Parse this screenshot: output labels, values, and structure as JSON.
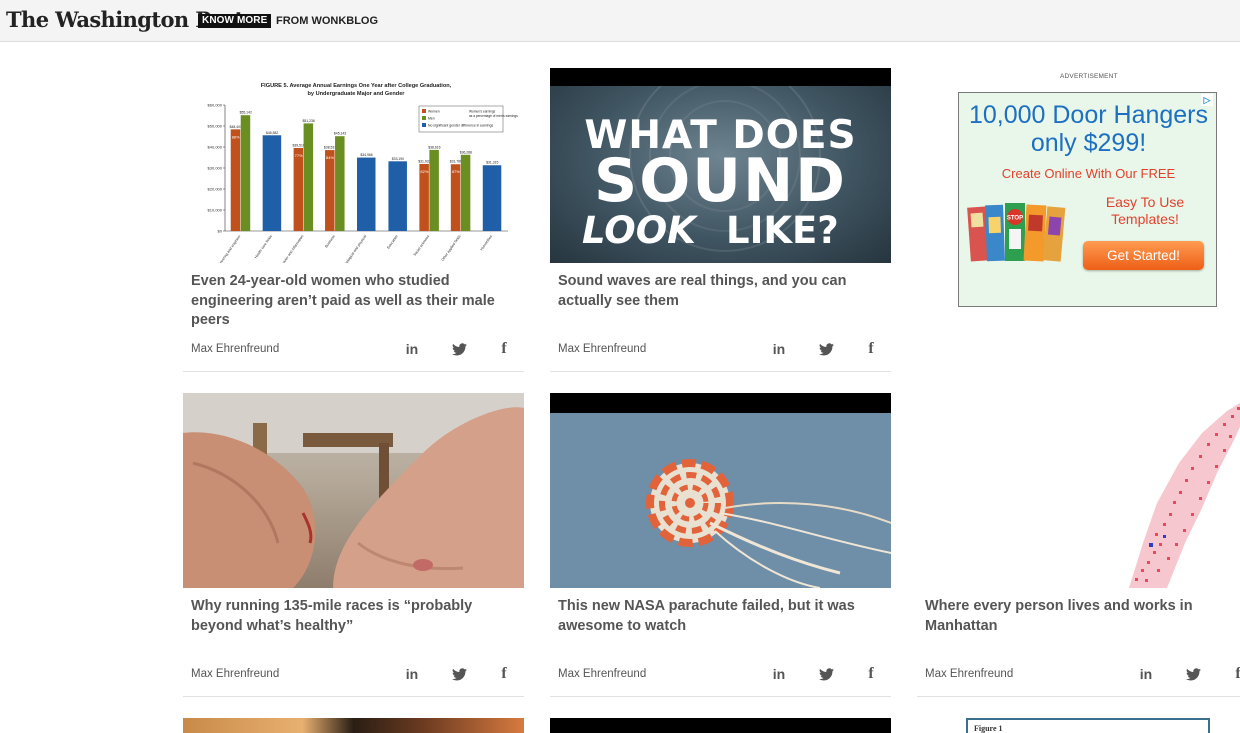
{
  "header": {
    "logo": "The Washington Post",
    "badge": "KNOW MORE",
    "section": "FROM WONKBLOG"
  },
  "advertisement": {
    "label": "ADVERTISEMENT",
    "title": "10,000 Door Hangers only $299!",
    "subtitle": "Create Online With Our FREE",
    "templates": "Easy To Use Templates!",
    "button": "Get Started!",
    "hanger_text": "STOP"
  },
  "cards": [
    {
      "headline": "Even 24-year-old women who studied engineering aren’t paid as well as their male peers",
      "author": "Max Ehrenfreund",
      "share": {
        "linkedin": "in",
        "facebook": "f"
      }
    },
    {
      "headline": "Sound waves are real things, and you can actually see them",
      "author": "Max Ehrenfreund",
      "image_text": {
        "l1": "WHAT DOES",
        "l2": "SOUND",
        "l3a": "LOOK",
        "l3b": "LIKE?"
      },
      "share": {
        "linkedin": "in",
        "facebook": "f"
      }
    },
    {
      "headline": "Why running 135-mile races is “probably beyond what’s healthy”",
      "author": "Max Ehrenfreund",
      "share": {
        "linkedin": "in",
        "facebook": "f"
      }
    },
    {
      "headline": "This new NASA parachute failed, but it was awesome to watch",
      "author": "Max Ehrenfreund",
      "share": {
        "linkedin": "in",
        "facebook": "f"
      }
    },
    {
      "headline": "Where every person lives and works in Manhattan",
      "author": "Max Ehrenfreund",
      "share": {
        "linkedin": "in",
        "facebook": "f"
      }
    }
  ],
  "figure_card": {
    "label": "Figure 1"
  },
  "chart_data": {
    "type": "bar",
    "title": "FIGURE 5. Average Annual Earnings One Year after College Graduation, by Undergraduate Major and Gender",
    "categories": [
      "Engineering and engineering technology",
      "Health care fields",
      "Computer and information sciences",
      "Business",
      "Biological and physical sciences, science technology, mathematics, and agricultural sciences",
      "Education",
      "Social sciences",
      "Other applied fields",
      "Humanities"
    ],
    "series": [
      {
        "name": "Women",
        "color": "#c0501c",
        "values": [
          48403,
          null,
          39510,
          38531,
          null,
          null,
          31933,
          31789,
          null
        ]
      },
      {
        "name": "Men",
        "color": "#6b8e23",
        "values": [
          55142,
          null,
          51236,
          45143,
          null,
          null,
          38616,
          36288,
          null
        ]
      },
      {
        "name": "No significant gender difference in earnings",
        "color": "#1f5fa8",
        "values": [
          null,
          45582,
          null,
          null,
          34966,
          33190,
          null,
          null,
          31315
        ]
      }
    ],
    "value_labels": [
      "$48,403",
      "$55,142",
      "$45,582",
      "$39,510",
      "$51,236",
      "$38,531",
      "$45,143",
      "$34,966",
      "$33,190",
      "$31,933",
      "$38,616",
      "$31,789",
      "$36,288",
      "$31,315"
    ],
    "percent_labels": [
      "88%",
      "77%",
      "84%",
      "82%",
      "87%"
    ],
    "legend_note": "Women's earnings as a percentage of men's earnings",
    "yticks": [
      "$0",
      "$10,000",
      "$20,000",
      "$30,000",
      "$40,000",
      "$50,000",
      "$60,000"
    ],
    "ylim": [
      0,
      60000
    ],
    "grid": false,
    "legend_position": "top-right"
  }
}
